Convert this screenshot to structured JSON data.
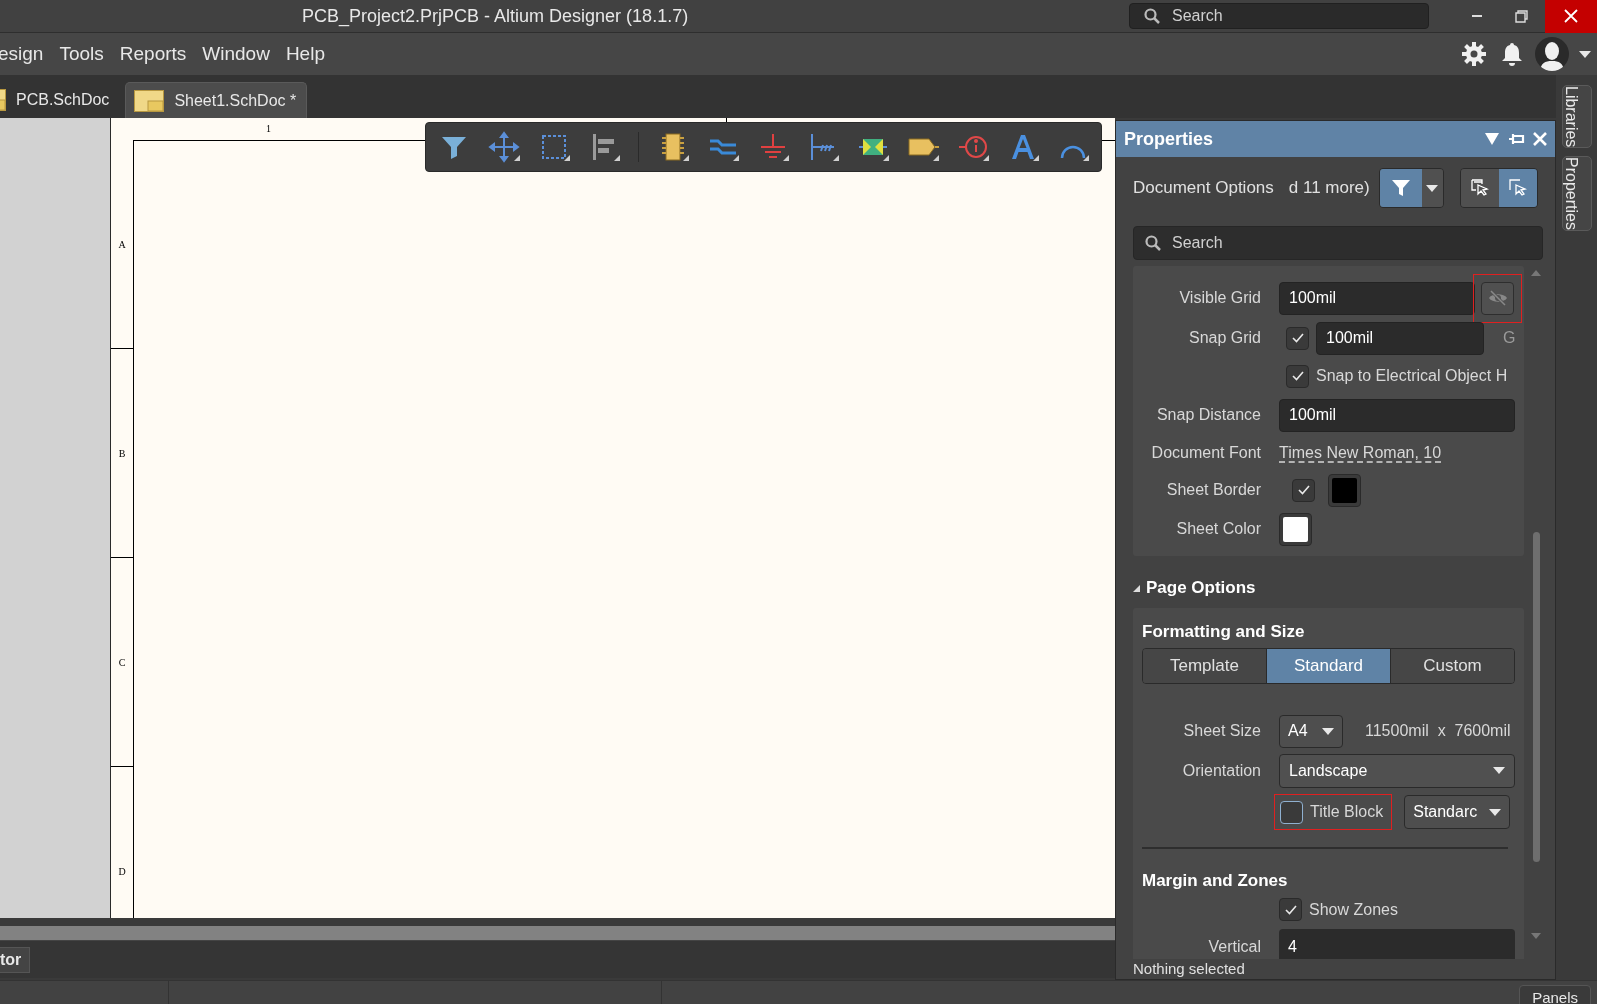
{
  "window": {
    "title": "PCB_Project2.PrjPCB - Altium Designer (18.1.7)",
    "search": {
      "placeholder": "Search"
    }
  },
  "menu": [
    "esign",
    "Tools",
    "Reports",
    "Window",
    "Help"
  ],
  "doc_tabs": [
    {
      "label": "PCB.SchDoc",
      "selected": false
    },
    {
      "label": "Sheet1.SchDoc *",
      "selected": true
    }
  ],
  "sheet": {
    "column_labels": [
      "1"
    ],
    "row_labels": [
      "A",
      "B",
      "C",
      "D"
    ]
  },
  "side_tabs": [
    "Libraries",
    "Properties"
  ],
  "properties": {
    "title": "Properties",
    "object": "Document Options",
    "filter_summary": "d 11 more)",
    "search": {
      "placeholder": "Search"
    },
    "general": [
      {
        "kind": "grid",
        "label": "Visible Grid",
        "value": "100mil",
        "highlighted": true
      },
      {
        "kind": "check_input",
        "label": "Snap Grid",
        "checked": true,
        "value": "100mil",
        "hotkey": "G"
      },
      {
        "kind": "check",
        "text": "Snap to Electrical Object H",
        "checked": true
      },
      {
        "kind": "input",
        "label": "Snap Distance",
        "value": "100mil"
      },
      {
        "kind": "link",
        "label": "Document Font",
        "value": "Times New Roman, 10"
      },
      {
        "kind": "check_color",
        "label": "Sheet Border",
        "checked": true,
        "color": "#000000"
      },
      {
        "kind": "color",
        "label": "Sheet Color",
        "color": "#ffffff"
      }
    ],
    "page_options": {
      "title": "Page Options",
      "expanded": true,
      "formatting": {
        "title": "Formatting and Size",
        "modes": [
          {
            "label": "Template",
            "selected": false
          },
          {
            "label": "Standard",
            "selected": true
          },
          {
            "label": "Custom",
            "selected": false
          }
        ],
        "sheet_size": {
          "label": "Sheet Size",
          "value": "A4",
          "dimensions": "11500mil  x  7600mil"
        },
        "orientation": {
          "label": "Orientation",
          "value": "Landscape"
        },
        "title_block": {
          "label": "Title Block",
          "checked": false,
          "highlighted": true,
          "style": "Standarc"
        }
      },
      "margins": {
        "title": "Margin and Zones",
        "show_zones": {
          "label": "Show Zones",
          "checked": true
        },
        "vertical": {
          "label": "Vertical",
          "value": "4"
        }
      }
    },
    "status": "Nothing selected"
  },
  "bottom": {
    "panel_tab": "tor",
    "panels_button": "Panels"
  }
}
